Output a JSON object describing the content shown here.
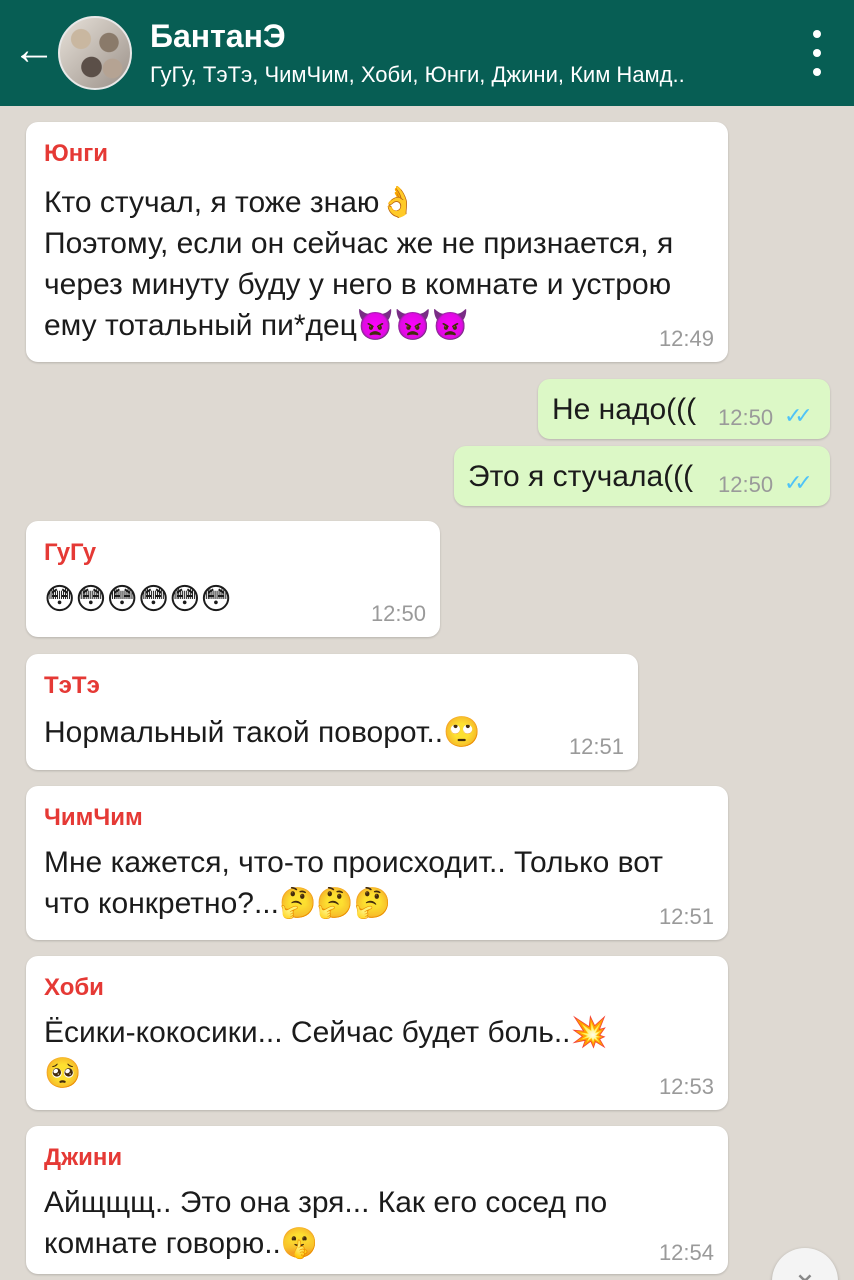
{
  "header": {
    "back_icon": "←",
    "title": "БантанЭ",
    "subtitle": "ГуГу, ТэТэ, ЧимЧим, Хоби, Юнги, Джини, Ким Намд..",
    "menu_icon": "more-vert-icon"
  },
  "messages": [
    {
      "sender": "Юнги",
      "text": "Кто стучал, я тоже знаю👌\nПоэтому, если он сейчас же не признается, я\nчерез минуту буду у него в комнате и устрою\nему тотальный пи*дец👿👿👿",
      "time": "12:49"
    },
    {
      "text": "Не надо(((",
      "time": "12:50",
      "status": "read"
    },
    {
      "text": "Это я стучала(((",
      "time": "12:50",
      "status": "read"
    },
    {
      "sender": "ГуГу",
      "text": "😳😳😳😳😳😳",
      "time": "12:50"
    },
    {
      "sender": "ТэТэ",
      "text": "Нормальный такой поворот..🙄",
      "time": "12:51"
    },
    {
      "sender": "ЧимЧим",
      "text": "Мне кажется, что-то происходит.. Только вот\nчто конкретно?...🤔🤔🤔",
      "time": "12:51"
    },
    {
      "sender": "Хоби",
      "text": "Ёсики-кокосики... Сейчас будет боль..💥\n🥺",
      "time": "12:53"
    },
    {
      "sender": "Джини",
      "text": "Айщщщ.. Это она зря... Как его сосед по\nкомнате говорю..🤫",
      "time": "12:54"
    }
  ],
  "ticks_glyph": "✓✓",
  "scroll_down_glyph": "⌄",
  "colors": {
    "header": "#075e54",
    "sender": "#e53935",
    "outgoing_bubble": "#dcf8c6",
    "read_ticks": "#4fc3f7"
  }
}
